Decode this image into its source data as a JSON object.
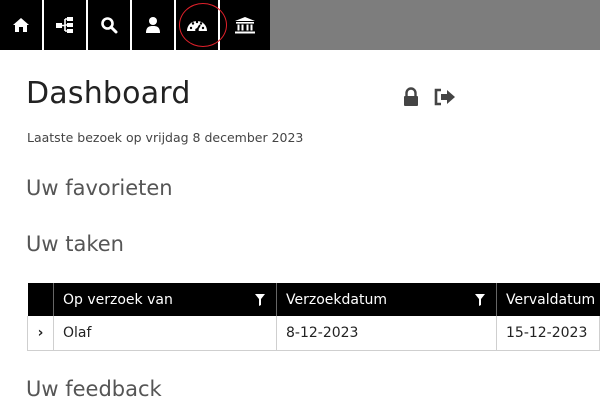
{
  "nav": {
    "items": [
      {
        "icon": "home-icon"
      },
      {
        "icon": "sitemap-icon"
      },
      {
        "icon": "search-icon"
      },
      {
        "icon": "user-icon"
      },
      {
        "icon": "dashboard-icon",
        "highlighted": true
      },
      {
        "icon": "institution-icon"
      }
    ]
  },
  "page": {
    "title": "Dashboard",
    "last_visit": "Laatste bezoek op vrijdag 8 december 2023"
  },
  "sections": {
    "favorites": "Uw favorieten",
    "tasks": "Uw taken",
    "feedback": "Uw feedback"
  },
  "tasks_table": {
    "headers": [
      "Op verzoek van",
      "Verzoekdatum",
      "Vervaldatum"
    ],
    "rows": [
      {
        "expand": "›",
        "from": "Olaf",
        "request_date": "8-12-2023",
        "due_date": "15-12-2023"
      }
    ]
  },
  "colors": {
    "nav_bg": "#000000",
    "topbar_bg": "#7d7d7d",
    "highlight_ring": "#e0202a"
  }
}
